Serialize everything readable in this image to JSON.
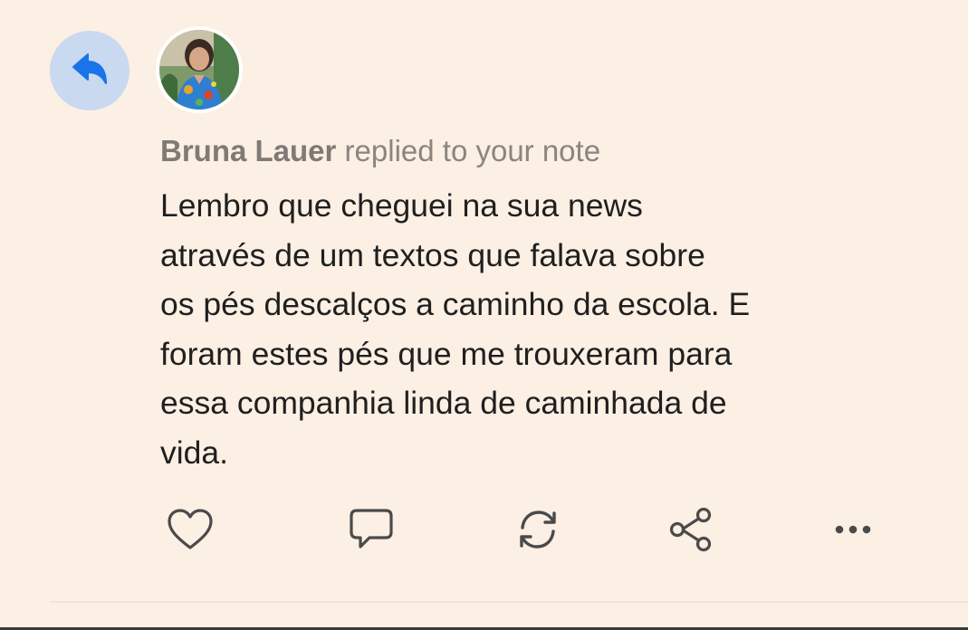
{
  "notification": {
    "type_icon": "reply-arrow-icon",
    "avatar_alt": "Bruna Lauer",
    "author": "Bruna Lauer",
    "action_text": "replied to your note",
    "body_lines": [
      "Lembro que cheguei na sua news",
      "através de um textos que falava sobre",
      "os pés descalços a caminho da escola. E",
      "foram estes pés que me trouxeram para",
      "essa companhia linda de caminhada de",
      "vida."
    ]
  },
  "actions": {
    "like_icon": "heart-icon",
    "reply_icon": "comment-icon",
    "restack_icon": "restack-icon",
    "share_icon": "share-icon",
    "more_icon": "more-icon"
  },
  "colors": {
    "background": "#fcefe4",
    "badge_background": "#c8d9f0",
    "badge_icon": "#1a73e8",
    "icon_stroke": "#4a4a4a",
    "text": "#1f1f1f",
    "muted_text": "#8a8580"
  }
}
